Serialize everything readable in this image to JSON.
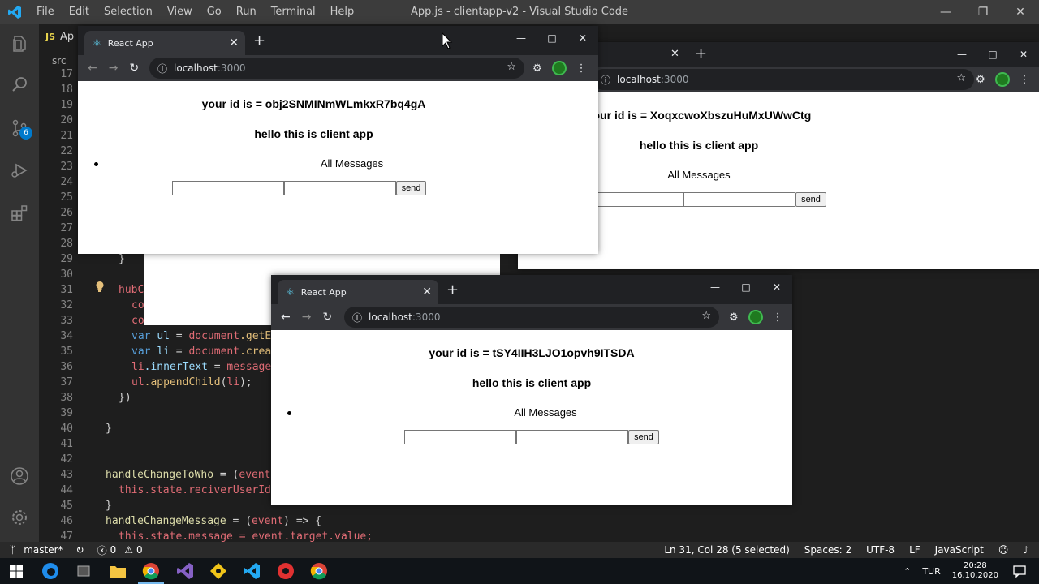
{
  "vscode": {
    "title": "App.js - clientapp-v2 - Visual Studio Code",
    "menu": [
      "File",
      "Edit",
      "Selection",
      "View",
      "Go",
      "Run",
      "Terminal",
      "Help"
    ],
    "tab": {
      "lang": "JS",
      "name": "Ap"
    },
    "breadcrumb": "src",
    "scm_badge": "6",
    "line_numbers": [
      "17",
      "18",
      "19",
      "20",
      "21",
      "22",
      "23",
      "24",
      "25",
      "26",
      "27",
      "28",
      "29",
      "30",
      "31",
      "32",
      "33",
      "34",
      "35",
      "36",
      "37",
      "38",
      "39",
      "40",
      "41",
      "42",
      "43",
      "44",
      "45",
      "46",
      "47"
    ],
    "code": {
      "l29": "}",
      "l31": "hubC",
      "l32": "co",
      "l33": "co",
      "l34_kw": "var",
      "l34_var": "ul",
      "l34_rest": " = ",
      "l34_doc": "document",
      "l34_fn": ".getE",
      "l35_kw": "var",
      "l35_var": "li",
      "l35_rest": " = ",
      "l35_doc": "document",
      "l35_fn": ".creat",
      "l36_a": "li",
      "l36_b": ".innerText",
      "l36_c": " = ",
      "l36_d": "message",
      "l37_a": "ul",
      "l37_b": ".appendChild",
      "l37_c": "(",
      "l37_d": "li",
      "l37_e": ");",
      "l38": "})",
      "l40": "}",
      "l43_fn": "handleChangeToWho",
      "l43_rest": " = (",
      "l43_arg": "event",
      "l43_end": ")",
      "l44_this": "this",
      "l44_rest": ".state.reciverUserId",
      "l45": "}",
      "l46_fn": "handleChangeMessage",
      "l46_rest": " = (",
      "l46_arg": "event",
      "l46_end": ") => {",
      "l47_this": "this",
      "l47_rest": ".state.message = event.target.value;"
    },
    "status": {
      "branch": "master*",
      "errors": "0",
      "warnings": "0",
      "position": "Ln 31, Col 28 (5 selected)",
      "spaces": "Spaces: 2",
      "encoding": "UTF-8",
      "eol": "LF",
      "language": "JavaScript"
    }
  },
  "taskbar": {
    "lang": "TUR",
    "time": "20:28",
    "date": "16.10.2020"
  },
  "browsers": [
    {
      "tab_title": "React App",
      "url_host": "localhost",
      "url_port": ":3000",
      "id_text": "your id is = obj2SNMINmWLmkxR7bq4gA",
      "heading": "hello this is client app",
      "messages_label": "All Messages",
      "send_label": "send"
    },
    {
      "tab_title": "",
      "url_host": "localhost",
      "url_port": ":3000",
      "id_text": "your id is = XoqxcwoXbszuHuMxUWwCtg",
      "heading": "hello this is client app",
      "messages_label": "All Messages",
      "send_label": "send"
    },
    {
      "tab_title": "React App",
      "url_host": "localhost",
      "url_port": ":3000",
      "id_text": "your id is = tSY4IIH3LJO1opvh9ITSDA",
      "heading": "hello this is client app",
      "messages_label": "All Messages",
      "send_label": "send"
    }
  ]
}
